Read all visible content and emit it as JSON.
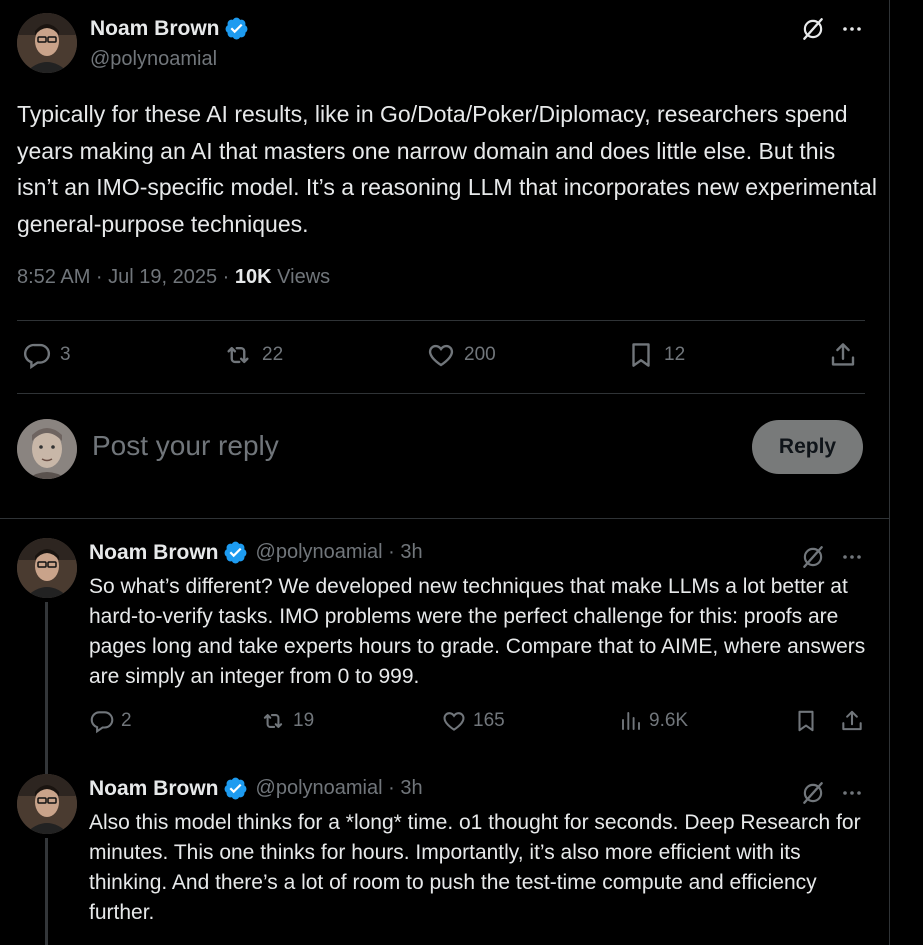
{
  "main_tweet": {
    "author_name": "Noam Brown",
    "author_handle": "@polynoamial",
    "text": "Typically for these AI results, like in Go/Dota/Poker/Diplomacy, researchers spend years making an AI that masters one narrow domain and does little else. But this isn’t an IMO-specific model. It’s a reasoning LLM that incorporates new experimental general-purpose techniques.",
    "time": "8:52 AM · Jul 19, 2025 · ",
    "views_count": "10K",
    "views_label": " Views",
    "replies": "3",
    "reposts": "22",
    "likes": "200",
    "bookmarks": "12"
  },
  "reply_composer": {
    "placeholder": "Post your reply",
    "button_label": "Reply"
  },
  "replies": [
    {
      "author_name": "Noam Brown",
      "author_handle": "@polynoamial · 3h",
      "text": "So what’s different? We developed new techniques that make LLMs a lot better at hard-to-verify tasks. IMO problems were the perfect challenge for this: proofs are pages long and take experts hours to grade. Compare that to AIME, where answers are simply an integer from 0 to 999.",
      "replies": "2",
      "reposts": "19",
      "likes": "165",
      "views": "9.6K"
    },
    {
      "author_name": "Noam Brown",
      "author_handle": "@polynoamial · 3h",
      "text": "Also this model thinks for a *long* time. o1 thought for seconds. Deep Research for minutes. This one thinks for hours. Importantly, it’s also more efficient with its thinking. And there’s a lot of room to push the test-time compute and efficiency further."
    }
  ],
  "colors": {
    "background": "#000000",
    "text_primary": "#e7e9ea",
    "text_secondary": "#71767b",
    "verified_blue": "#1d9bf0",
    "divider": "#2f3336",
    "reply_button_bg": "#787a7a"
  },
  "icons": [
    "verified-badge-icon",
    "grok-icon",
    "more-icon",
    "reply-icon",
    "repost-icon",
    "like-icon",
    "bookmark-icon",
    "share-icon",
    "views-icon"
  ]
}
